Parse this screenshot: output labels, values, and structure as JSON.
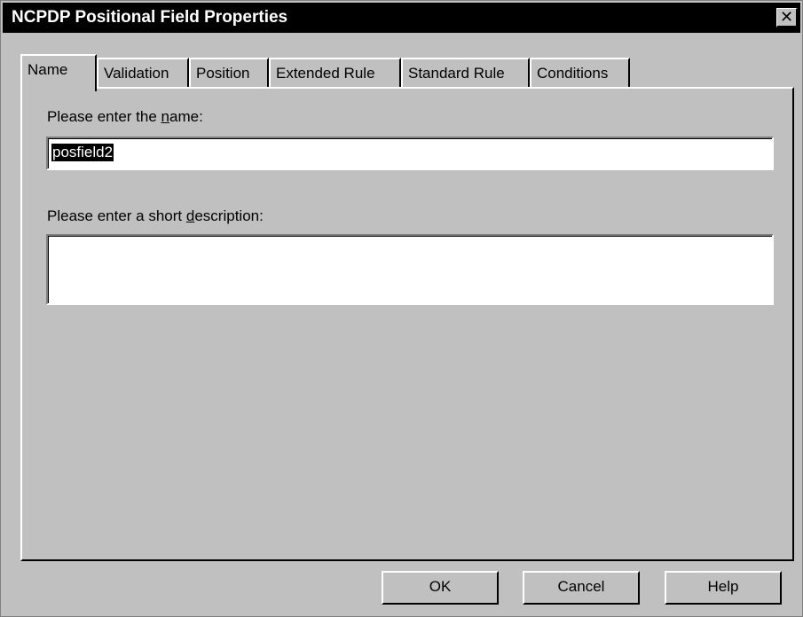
{
  "window": {
    "title": "NCPDP Positional Field Properties",
    "close_glyph": "✕"
  },
  "tabs": [
    {
      "label": "Name",
      "active": true
    },
    {
      "label": "Validation",
      "active": false
    },
    {
      "label": "Position",
      "active": false
    },
    {
      "label": "Extended Rule",
      "active": false
    },
    {
      "label": "Standard Rule",
      "active": false
    },
    {
      "label": "Conditions",
      "active": false
    }
  ],
  "form": {
    "name_label_pre": "Please enter the ",
    "name_label_accel": "n",
    "name_label_post": "ame:",
    "name_value": "posfield2",
    "desc_label_pre": "Please enter a short ",
    "desc_label_accel": "d",
    "desc_label_post": "escription:",
    "desc_value": ""
  },
  "buttons": {
    "ok": "OK",
    "cancel": "Cancel",
    "help": "Help"
  }
}
